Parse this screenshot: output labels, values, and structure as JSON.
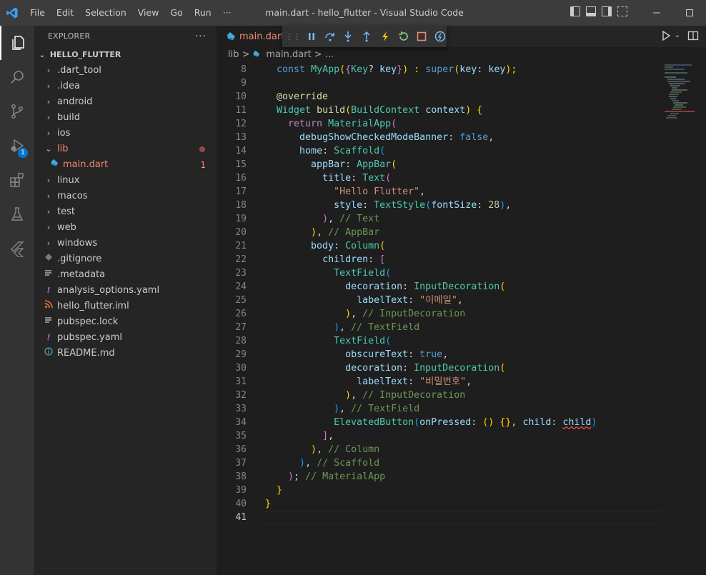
{
  "window": {
    "title": "main.dart - hello_flutter - Visual Studio Code",
    "menu": [
      "File",
      "Edit",
      "Selection",
      "View",
      "Go",
      "Run",
      "···"
    ],
    "restore_symbol": "☐"
  },
  "activity_bar": {
    "items": [
      "explorer",
      "search",
      "source-control",
      "run-debug",
      "extensions",
      "testing",
      "flutter"
    ],
    "debug_badge": "1"
  },
  "explorer": {
    "header": "EXPLORER",
    "more": "···",
    "folder": "HELLO_FLUTTER",
    "items": [
      {
        "label": ".dart_tool",
        "type": "folder",
        "color": "#cccccc"
      },
      {
        "label": ".idea",
        "type": "folder",
        "color": "#cccccc"
      },
      {
        "label": "android",
        "type": "folder",
        "color": "#cccccc"
      },
      {
        "label": "build",
        "type": "folder",
        "color": "#cccccc"
      },
      {
        "label": "ios",
        "type": "folder",
        "color": "#cccccc"
      },
      {
        "label": "lib",
        "type": "folder-open",
        "color": "#f48771",
        "dot": true
      },
      {
        "label": "main.dart",
        "type": "dart",
        "color": "#f48771",
        "count": "1"
      },
      {
        "label": "linux",
        "type": "folder",
        "color": "#cccccc"
      },
      {
        "label": "macos",
        "type": "folder",
        "color": "#cccccc"
      },
      {
        "label": "test",
        "type": "folder",
        "color": "#cccccc"
      },
      {
        "label": "web",
        "type": "folder",
        "color": "#cccccc"
      },
      {
        "label": "windows",
        "type": "folder",
        "color": "#cccccc"
      },
      {
        "label": ".gitignore",
        "type": "gitignore",
        "color": "#cccccc"
      },
      {
        "label": ".metadata",
        "type": "lines",
        "color": "#cccccc"
      },
      {
        "label": "analysis_options.yaml",
        "type": "yaml",
        "color": "#cccccc"
      },
      {
        "label": "hello_flutter.iml",
        "type": "rss",
        "color": "#cccccc"
      },
      {
        "label": "pubspec.lock",
        "type": "lines",
        "color": "#cccccc"
      },
      {
        "label": "pubspec.yaml",
        "type": "yaml",
        "color": "#cccccc"
      },
      {
        "label": "README.md",
        "type": "info",
        "color": "#cccccc"
      }
    ]
  },
  "editor": {
    "tab_label": "main.dart",
    "breadcrumb": [
      "lib",
      ">",
      "main.dart",
      ">",
      "..."
    ],
    "line_numbers": [
      "8",
      "9",
      "10",
      "11",
      "12",
      "13",
      "14",
      "15",
      "16",
      "17",
      "18",
      "19",
      "20",
      "21",
      "22",
      "23",
      "24",
      "25",
      "26",
      "27",
      "28",
      "29",
      "30",
      "31",
      "32",
      "33",
      "34",
      "35",
      "36",
      "37",
      "38",
      "39",
      "40",
      "41"
    ],
    "lines": [
      [
        [
          "  ",
          "p"
        ],
        [
          "const ",
          "k"
        ],
        [
          "MyApp",
          "t"
        ],
        [
          "(",
          "b1"
        ],
        [
          "{",
          "b2"
        ],
        [
          "Key",
          "t"
        ],
        [
          "? ",
          "p"
        ],
        [
          "key",
          "v"
        ],
        [
          "}",
          "b2"
        ],
        [
          ") : ",
          "b1"
        ],
        [
          "super",
          "k"
        ],
        [
          "(",
          "b1"
        ],
        [
          "key",
          "v"
        ],
        [
          ": ",
          "p"
        ],
        [
          "key",
          "v"
        ],
        [
          ");",
          "b1"
        ]
      ],
      [],
      [
        [
          "  ",
          "p"
        ],
        [
          "@override",
          "f"
        ]
      ],
      [
        [
          "  ",
          "p"
        ],
        [
          "Widget ",
          "t"
        ],
        [
          "build",
          "f"
        ],
        [
          "(",
          "b1"
        ],
        [
          "BuildContext ",
          "t"
        ],
        [
          "context",
          "v"
        ],
        [
          ") ",
          "b1"
        ],
        [
          "{",
          "b1"
        ]
      ],
      [
        [
          "    ",
          "p"
        ],
        [
          "return ",
          "c"
        ],
        [
          "MaterialApp",
          "t"
        ],
        [
          "(",
          "b2"
        ]
      ],
      [
        [
          "      ",
          "p"
        ],
        [
          "debugShowCheckedModeBanner",
          "v"
        ],
        [
          ": ",
          "p"
        ],
        [
          "false",
          "k"
        ],
        [
          ",",
          "p"
        ]
      ],
      [
        [
          "      ",
          "p"
        ],
        [
          "home",
          "v"
        ],
        [
          ": ",
          "p"
        ],
        [
          "Scaffold",
          "t"
        ],
        [
          "(",
          "b3"
        ]
      ],
      [
        [
          "        ",
          "p"
        ],
        [
          "appBar",
          "v"
        ],
        [
          ": ",
          "p"
        ],
        [
          "AppBar",
          "t"
        ],
        [
          "(",
          "b1"
        ]
      ],
      [
        [
          "          ",
          "p"
        ],
        [
          "title",
          "v"
        ],
        [
          ": ",
          "p"
        ],
        [
          "Text",
          "t"
        ],
        [
          "(",
          "b2"
        ]
      ],
      [
        [
          "            ",
          "p"
        ],
        [
          "\"Hello Flutter\"",
          "s"
        ],
        [
          ",",
          "p"
        ]
      ],
      [
        [
          "            ",
          "p"
        ],
        [
          "style",
          "v"
        ],
        [
          ": ",
          "p"
        ],
        [
          "TextStyle",
          "t"
        ],
        [
          "(",
          "b3"
        ],
        [
          "fontSize",
          "v"
        ],
        [
          ": ",
          "p"
        ],
        [
          "28",
          "n"
        ],
        [
          ")",
          "b3"
        ],
        [
          ",",
          "p"
        ]
      ],
      [
        [
          "          ",
          "p"
        ],
        [
          ")",
          "b2"
        ],
        [
          ", ",
          "p"
        ],
        [
          "// Text",
          "cm"
        ]
      ],
      [
        [
          "        ",
          "p"
        ],
        [
          ")",
          "b1"
        ],
        [
          ", ",
          "p"
        ],
        [
          "// AppBar",
          "cm"
        ]
      ],
      [
        [
          "        ",
          "p"
        ],
        [
          "body",
          "v"
        ],
        [
          ": ",
          "p"
        ],
        [
          "Column",
          "t"
        ],
        [
          "(",
          "b1"
        ]
      ],
      [
        [
          "          ",
          "p"
        ],
        [
          "children",
          "v"
        ],
        [
          ": ",
          "p"
        ],
        [
          "[",
          "b2"
        ]
      ],
      [
        [
          "            ",
          "p"
        ],
        [
          "TextField",
          "t"
        ],
        [
          "(",
          "b3"
        ]
      ],
      [
        [
          "              ",
          "p"
        ],
        [
          "decoration",
          "v"
        ],
        [
          ": ",
          "p"
        ],
        [
          "InputDecoration",
          "t"
        ],
        [
          "(",
          "b1"
        ]
      ],
      [
        [
          "                ",
          "p"
        ],
        [
          "labelText",
          "v"
        ],
        [
          ": ",
          "p"
        ],
        [
          "\"이메일\"",
          "s"
        ],
        [
          ",",
          "p"
        ]
      ],
      [
        [
          "              ",
          "p"
        ],
        [
          ")",
          "b1"
        ],
        [
          ", ",
          "p"
        ],
        [
          "// InputDecoration",
          "cm"
        ]
      ],
      [
        [
          "            ",
          "p"
        ],
        [
          ")",
          "b3"
        ],
        [
          ", ",
          "p"
        ],
        [
          "// TextField",
          "cm"
        ]
      ],
      [
        [
          "            ",
          "p"
        ],
        [
          "TextField",
          "t"
        ],
        [
          "(",
          "b3"
        ]
      ],
      [
        [
          "              ",
          "p"
        ],
        [
          "obscureText",
          "v"
        ],
        [
          ": ",
          "p"
        ],
        [
          "true",
          "k"
        ],
        [
          ",",
          "p"
        ]
      ],
      [
        [
          "              ",
          "p"
        ],
        [
          "decoration",
          "v"
        ],
        [
          ": ",
          "p"
        ],
        [
          "InputDecoration",
          "t"
        ],
        [
          "(",
          "b1"
        ]
      ],
      [
        [
          "                ",
          "p"
        ],
        [
          "labelText",
          "v"
        ],
        [
          ": ",
          "p"
        ],
        [
          "\"비밀번호\"",
          "s"
        ],
        [
          ",",
          "p"
        ]
      ],
      [
        [
          "              ",
          "p"
        ],
        [
          ")",
          "b1"
        ],
        [
          ", ",
          "p"
        ],
        [
          "// InputDecoration",
          "cm"
        ]
      ],
      [
        [
          "            ",
          "p"
        ],
        [
          ")",
          "b3"
        ],
        [
          ", ",
          "p"
        ],
        [
          "// TextField",
          "cm"
        ]
      ],
      [
        [
          "            ",
          "p"
        ],
        [
          "ElevatedButton",
          "t"
        ],
        [
          "(",
          "b3"
        ],
        [
          "onPressed",
          "v"
        ],
        [
          ": ",
          "p"
        ],
        [
          "() ",
          "b1"
        ],
        [
          "{}",
          "b1"
        ],
        [
          ", ",
          "p"
        ],
        [
          "child",
          "v"
        ],
        [
          ": ",
          "p"
        ],
        [
          "child",
          "v squig"
        ],
        [
          ")",
          "b3"
        ]
      ],
      [
        [
          "          ",
          "p"
        ],
        [
          "]",
          "b2"
        ],
        [
          ",",
          "p"
        ]
      ],
      [
        [
          "        ",
          "p"
        ],
        [
          ")",
          "b1"
        ],
        [
          ", ",
          "p"
        ],
        [
          "// Column",
          "cm"
        ]
      ],
      [
        [
          "      ",
          "p"
        ],
        [
          ")",
          "b3"
        ],
        [
          ", ",
          "p"
        ],
        [
          "// Scaffold",
          "cm"
        ]
      ],
      [
        [
          "    ",
          "p"
        ],
        [
          ")",
          "b2"
        ],
        [
          "; ",
          "p"
        ],
        [
          "// MaterialApp",
          "cm"
        ]
      ],
      [
        [
          "  ",
          "p"
        ],
        [
          "}",
          "b1"
        ]
      ],
      [
        [
          "}",
          "b1"
        ]
      ],
      []
    ]
  }
}
